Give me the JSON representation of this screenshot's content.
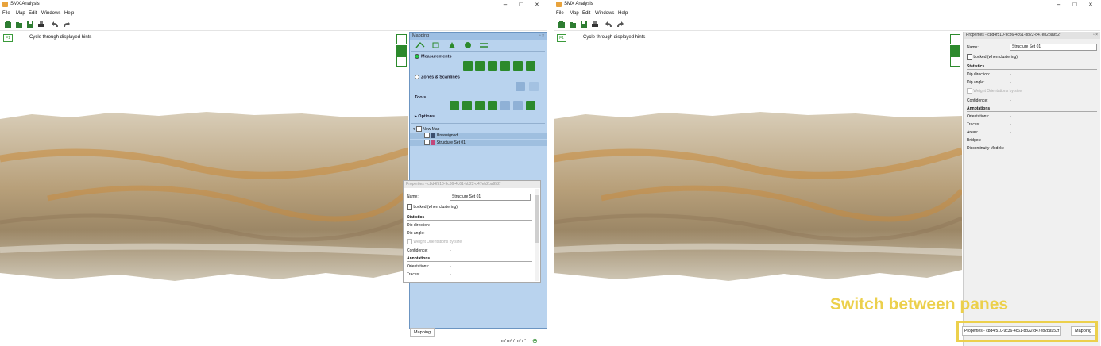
{
  "app": {
    "title": "SMX Analysis"
  },
  "menu": {
    "file": "File",
    "map": "Map",
    "edit": "Edit",
    "windows": "Windows",
    "help": "Help"
  },
  "hint": {
    "key": "F1",
    "text": "Cycle through displayed hints"
  },
  "mapping": {
    "title": "Mapping",
    "measurements": "Measurements",
    "zones": "Zones & Scanlines",
    "tools": "Tools",
    "options": "Options",
    "tree": {
      "root": "New Map",
      "items": [
        "Unassigned",
        "Structure Set 01"
      ]
    },
    "swatch_colors": [
      "#3c4f6e",
      "#c2477a"
    ]
  },
  "properties": {
    "title": "Properties - c8d4f510-9c36-4c61-bb22-d47eb2ba952f",
    "name_label": "Name:",
    "name_value": "Structure Set 01",
    "locked": "Locked (when clustering)",
    "statistics": "Statistics",
    "dip_direction": "Dip direction:",
    "dip_angle": "Dip angle:",
    "weight": "Weight Orientations by size",
    "confidence": "Confidence:",
    "annotations": "Annotations",
    "orientations": "Orientations:",
    "traces": "Traces:",
    "areas": "Areas:",
    "bridges": "Bridges:",
    "discontinuity": "Discontinuity Models:",
    "dash": "-"
  },
  "status": {
    "units": "m / m² / m³ / °"
  },
  "bottom_tabs": {
    "mapping": "Mapping",
    "properties": "Properties - c8d4f510-9c36-4c61-bb22-d47eb2ba952f"
  },
  "callout": {
    "text": "Switch between panes"
  },
  "colors": {
    "accent_green": "#2c8a2c",
    "callout_yellow": "#ecd04c",
    "panel_blue": "#b9d3ee"
  }
}
